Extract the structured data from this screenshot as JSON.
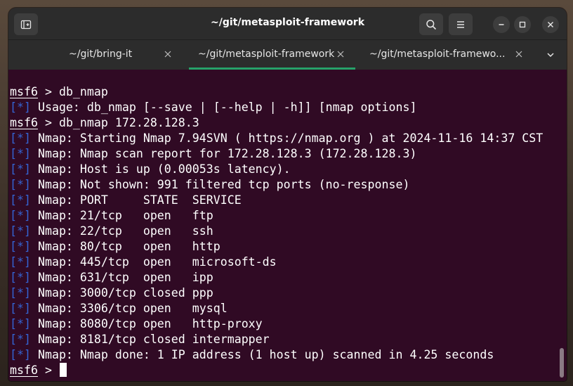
{
  "window": {
    "title": "~/git/metasploit-framework"
  },
  "tabs": [
    {
      "label": "~/git/bring-it",
      "active": false
    },
    {
      "label": "~/git/metasploit-framework",
      "active": true
    },
    {
      "label": "~/git/metasploit-framewo...",
      "active": false
    }
  ],
  "icons": {
    "new_tab": "new-tab-icon",
    "search": "search-icon",
    "menu": "hamburger-menu-icon",
    "minimize": "minimize-icon",
    "maximize": "maximize-icon",
    "close": "close-icon",
    "tab_close": "close-icon",
    "tab_overflow": "chevron-down-icon"
  },
  "colors": {
    "terminal_bg": "#300a24",
    "headerbar_bg": "#2c2c2c",
    "accent_tab": "#26a269",
    "tag_blue": "#3465d4",
    "text": "#ffffff"
  },
  "terminal": {
    "prompt": "msf6",
    "prompt_suffix": " > ",
    "tag": "[*]",
    "cmd1": "db_nmap",
    "cmd2": "db_nmap 172.28.128.3",
    "usage": " Usage: db_nmap [--save | [--help | -h]] [nmap options]",
    "output": [
      " Nmap: Starting Nmap 7.94SVN ( https://nmap.org ) at 2024-11-16 14:37 CST",
      " Nmap: Nmap scan report for 172.28.128.3 (172.28.128.3)",
      " Nmap: Host is up (0.00053s latency).",
      " Nmap: Not shown: 991 filtered tcp ports (no-response)",
      " Nmap: PORT     STATE  SERVICE",
      " Nmap: 21/tcp   open   ftp",
      " Nmap: 22/tcp   open   ssh",
      " Nmap: 80/tcp   open   http",
      " Nmap: 445/tcp  open   microsoft-ds",
      " Nmap: 631/tcp  open   ipp",
      " Nmap: 3000/tcp closed ppp",
      " Nmap: 3306/tcp open   mysql",
      " Nmap: 8080/tcp open   http-proxy",
      " Nmap: 8181/tcp closed intermapper",
      " Nmap: Nmap done: 1 IP address (1 host up) scanned in 4.25 seconds"
    ]
  }
}
